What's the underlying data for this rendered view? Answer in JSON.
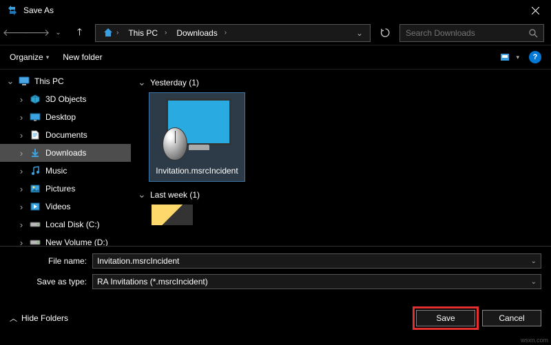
{
  "window": {
    "title": "Save As"
  },
  "nav": {
    "breadcrumb": [
      "This PC",
      "Downloads"
    ],
    "search_placeholder": "Search Downloads"
  },
  "toolbar": {
    "organize": "Organize",
    "new_folder": "New folder"
  },
  "sidebar": {
    "items": [
      {
        "label": "This PC",
        "expanded": true,
        "level": 1,
        "icon": "pc"
      },
      {
        "label": "3D Objects",
        "level": 2,
        "icon": "3d"
      },
      {
        "label": "Desktop",
        "level": 2,
        "icon": "desktop"
      },
      {
        "label": "Documents",
        "level": 2,
        "icon": "docs"
      },
      {
        "label": "Downloads",
        "level": 2,
        "icon": "down",
        "selected": true
      },
      {
        "label": "Music",
        "level": 2,
        "icon": "music"
      },
      {
        "label": "Pictures",
        "level": 2,
        "icon": "pics"
      },
      {
        "label": "Videos",
        "level": 2,
        "icon": "video"
      },
      {
        "label": "Local Disk (C:)",
        "level": 2,
        "icon": "disk"
      },
      {
        "label": "New Volume (D:)",
        "level": 2,
        "icon": "disk"
      }
    ]
  },
  "content": {
    "groups": [
      {
        "title": "Yesterday (1)",
        "items": [
          {
            "label": "Invitation.msrcIncident",
            "selected": true
          }
        ]
      },
      {
        "title": "Last week (1)",
        "items": []
      }
    ]
  },
  "form": {
    "filename_label": "File name:",
    "filename_value": "Invitation.msrcIncident",
    "type_label": "Save as type:",
    "type_value": "RA Invitations (*.msrcIncident)"
  },
  "footer": {
    "hide_folders": "Hide Folders",
    "save": "Save",
    "cancel": "Cancel"
  },
  "watermark": "wsxn.com"
}
